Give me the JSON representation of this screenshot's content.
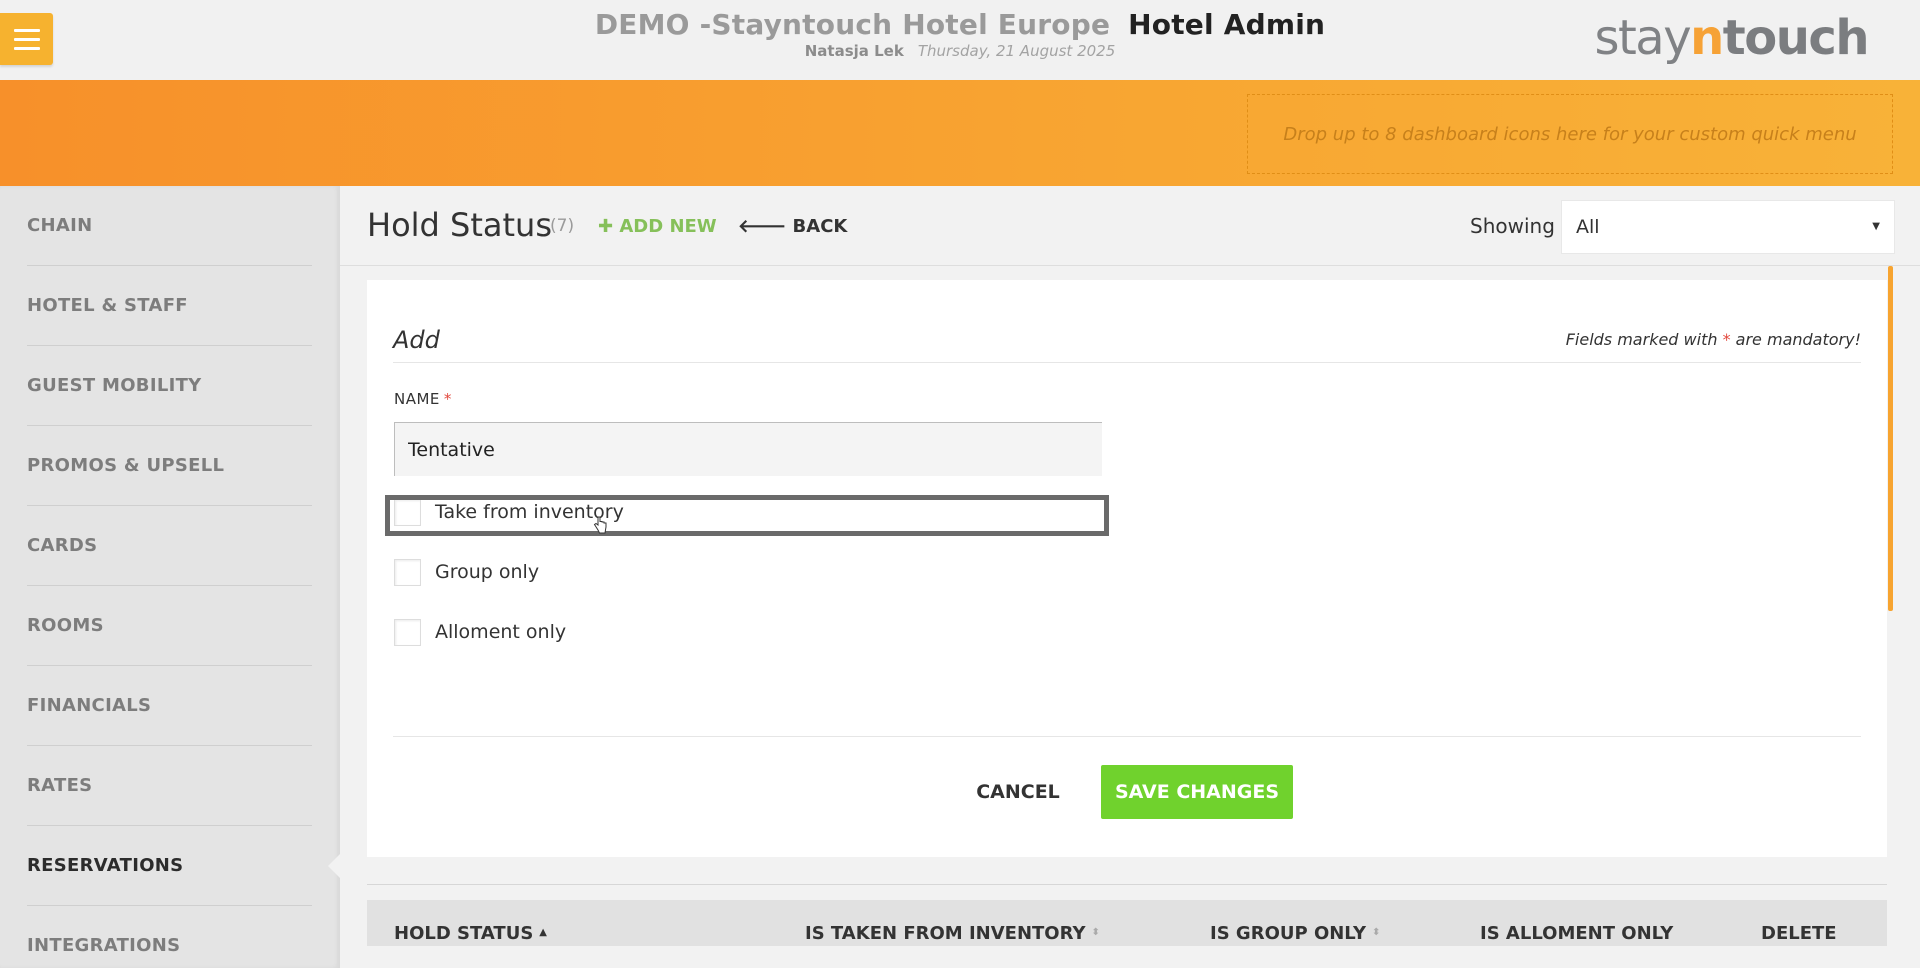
{
  "header": {
    "property": "DEMO -Stayntouch Hotel Europe",
    "app": "Hotel Admin",
    "user": "Natasja Lek",
    "date": "Thursday, 21 August 2025",
    "logo_pre": "stay",
    "logo_n": "n",
    "logo_post": "touch"
  },
  "quick_menu": {
    "placeholder": "Drop up to 8 dashboard icons here for your custom quick menu"
  },
  "sidebar": {
    "items": [
      {
        "label": "CHAIN"
      },
      {
        "label": "HOTEL & STAFF"
      },
      {
        "label": "GUEST MOBILITY"
      },
      {
        "label": "PROMOS & UPSELL"
      },
      {
        "label": "CARDS"
      },
      {
        "label": "ROOMS"
      },
      {
        "label": "FINANCIALS"
      },
      {
        "label": "RATES"
      },
      {
        "label": "RESERVATIONS"
      },
      {
        "label": "INTEGRATIONS"
      }
    ],
    "active": "RESERVATIONS"
  },
  "page": {
    "title": "Hold Status",
    "count": "(7)",
    "add_new": "ADD NEW",
    "back": "BACK",
    "showing_label": "Showing",
    "showing_value": "All"
  },
  "form": {
    "title": "Add",
    "mandatory_pre": "Fields marked with",
    "mandatory_star": "*",
    "mandatory_post": "are mandatory!",
    "name_label": "NAME",
    "name_star": "*",
    "name_value": "Tentative",
    "checkboxes": [
      {
        "label": "Take from inventory",
        "checked": false
      },
      {
        "label": "Group only",
        "checked": false
      },
      {
        "label": "Alloment only",
        "checked": false
      }
    ],
    "cancel": "CANCEL",
    "save": "SAVE CHANGES"
  },
  "table": {
    "columns": [
      {
        "label": "HOLD STATUS",
        "sort": "asc"
      },
      {
        "label": "IS TAKEN FROM INVENTORY",
        "sort": "both"
      },
      {
        "label": "IS GROUP ONLY",
        "sort": "both"
      },
      {
        "label": "IS ALLOMENT ONLY",
        "sort": "none"
      },
      {
        "label": "DELETE",
        "sort": "none"
      }
    ]
  },
  "colors": {
    "accent_orange": "#f7902a",
    "menu_button": "#f6b22f",
    "save_green": "#70d22d",
    "add_new_green": "#86c05a",
    "required_red": "#e2473c"
  },
  "icons": {
    "menu": "hamburger-icon",
    "add": "plus-icon",
    "back": "arrow-left-icon",
    "select_caret": "caret-down-icon",
    "sort_asc": "sort-asc-icon",
    "sort_both": "sort-both-icon",
    "cursor": "hand-cursor-icon"
  }
}
